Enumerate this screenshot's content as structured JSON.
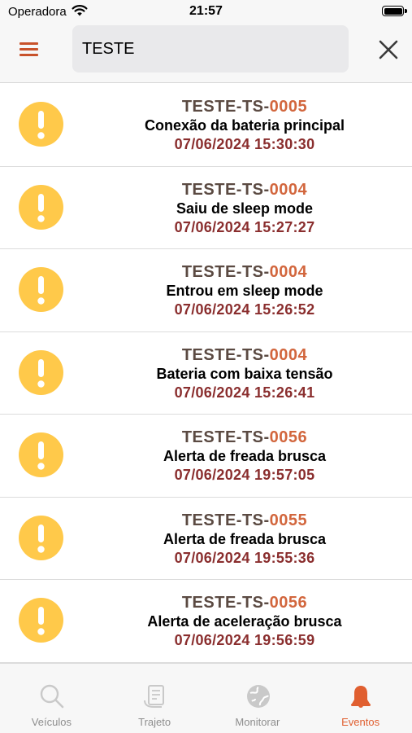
{
  "status_bar": {
    "carrier": "Operadora",
    "time": "21:57"
  },
  "search": {
    "value": "TESTE",
    "placeholder": ""
  },
  "colors": {
    "accent": "#c8522b",
    "id_prefix": "#5b4a42",
    "id_suffix": "#d2663d",
    "timestamp": "#8a2e2e",
    "alert_icon": "#ffc94a",
    "active_tab": "#e05f30"
  },
  "events": [
    {
      "id_prefix": "TESTE-TS-",
      "id_suffix": "0005",
      "description": "Conexão da bateria principal",
      "timestamp": "07/06/2024 15:30:30",
      "icon": "exclamation-alert-icon"
    },
    {
      "id_prefix": "TESTE-TS-",
      "id_suffix": "0004",
      "description": "Saiu de sleep mode",
      "timestamp": "07/06/2024 15:27:27",
      "icon": "exclamation-alert-icon"
    },
    {
      "id_prefix": "TESTE-TS-",
      "id_suffix": "0004",
      "description": "Entrou em sleep mode",
      "timestamp": "07/06/2024 15:26:52",
      "icon": "exclamation-alert-icon"
    },
    {
      "id_prefix": "TESTE-TS-",
      "id_suffix": "0004",
      "description": "Bateria com baixa tensão",
      "timestamp": "07/06/2024 15:26:41",
      "icon": "exclamation-alert-icon"
    },
    {
      "id_prefix": "TESTE-TS-",
      "id_suffix": "0056",
      "description": "Alerta de freada brusca",
      "timestamp": "07/06/2024 19:57:05",
      "icon": "exclamation-alert-icon"
    },
    {
      "id_prefix": "TESTE-TS-",
      "id_suffix": "0055",
      "description": "Alerta de freada brusca",
      "timestamp": "07/06/2024 19:55:36",
      "icon": "exclamation-alert-icon"
    },
    {
      "id_prefix": "TESTE-TS-",
      "id_suffix": "0056",
      "description": "Alerta de aceleração brusca",
      "timestamp": "07/06/2024 19:56:59",
      "icon": "exclamation-alert-icon"
    }
  ],
  "tabs": [
    {
      "label": "Veículos",
      "icon": "magnifier-icon",
      "active": false
    },
    {
      "label": "Trajeto",
      "icon": "route-map-icon",
      "active": false
    },
    {
      "label": "Monitorar",
      "icon": "globe-icon",
      "active": false
    },
    {
      "label": "Eventos",
      "icon": "bell-icon",
      "active": true
    }
  ]
}
